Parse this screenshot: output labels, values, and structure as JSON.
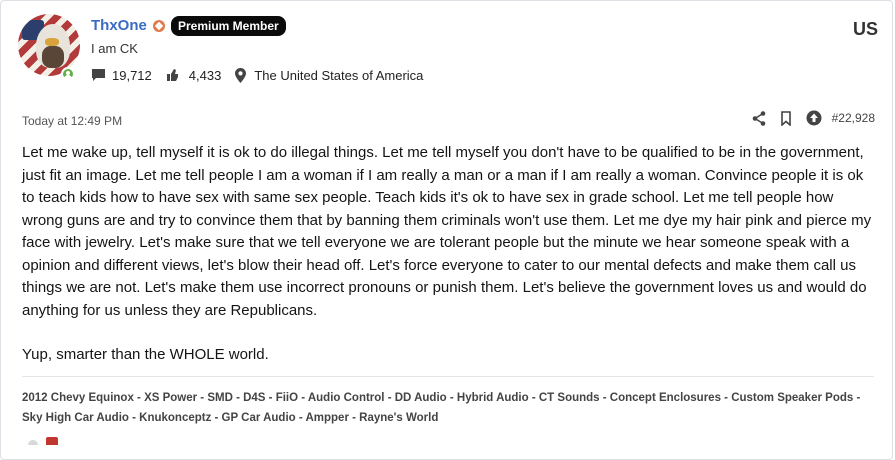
{
  "user": {
    "name": "ThxOne",
    "badge": "Premium Member",
    "title": "I am CK",
    "country_code": "US",
    "messages": "19,712",
    "reactions": "4,433",
    "location": "The United States of America"
  },
  "post": {
    "timestamp": "Today at 12:49 PM",
    "number": "#22,928",
    "paragraphs": [
      "Let me wake up, tell myself it is ok to do illegal things. Let me tell myself you don't have to be qualified to be in the government, just fit an image. Let me tell people I am a woman if I am really a man or a man if I am really a woman. Convince people it is ok to teach kids how to have sex with same sex people. Teach kids it's ok to have sex in grade school. Let me tell people how wrong guns are and try to convince them that by banning them criminals won't use them. Let me dye my hair pink and pierce my face with jewelry. Let's make sure that we tell everyone we are tolerant people but the minute we hear someone speak with a opinion and different views, let's blow their head off. Let's force everyone to cater to our mental defects and make them call us things we are not. Let's make them use incorrect pronouns or punish them. Let's believe the government loves us and would do anything for us unless they are Republicans.",
      "Yup, smarter than the WHOLE world."
    ],
    "signature": "2012 Chevy Equinox - XS Power - SMD - D4S - FiiO - Audio Control - DD Audio - Hybrid Audio - CT Sounds - Concept Enclosures - Custom Speaker Pods - Sky High Car Audio - Knukonceptz - GP Car Audio - Ampper - Rayne's World"
  },
  "icons": {
    "messages": "speech-bubble-icon",
    "reactions": "thumbs-icon",
    "location": "map-pin-icon",
    "share": "share-icon",
    "bookmark": "bookmark-icon",
    "upvote": "arrow-up-circle-icon"
  },
  "colors": {
    "username": "#3a6bc4",
    "badge_bg": "#0b0b0b",
    "online": "#63b04b",
    "moderator": "#e07a4a"
  }
}
